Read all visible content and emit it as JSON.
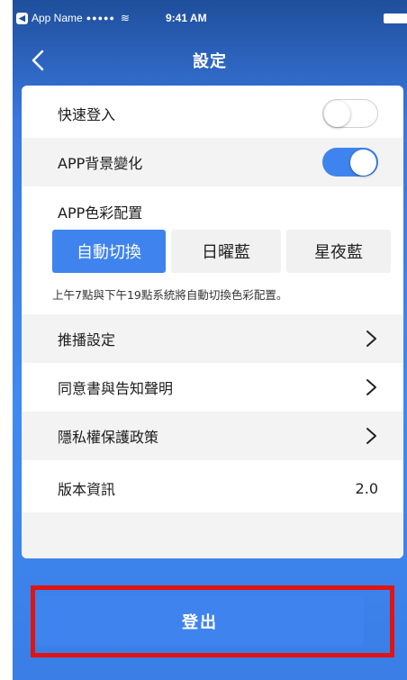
{
  "status_bar": {
    "back_app_label": "App Name",
    "back_app_badge": "◀",
    "signal": "●●●●●",
    "wifi": "≋",
    "time": "9:41 AM"
  },
  "nav": {
    "title": "設定",
    "back_icon": "chevron-left-icon"
  },
  "settings": {
    "quick_login": {
      "label": "快速登入",
      "enabled": false
    },
    "bg_change": {
      "label": "APP背景變化",
      "enabled": true
    },
    "color_config": {
      "title": "APP色彩配置",
      "options": [
        "自動切換",
        "日曜藍",
        "星夜藍"
      ],
      "selected": "自動切換",
      "note": "上午7點與下午19點系統將自動切換色彩配置。"
    },
    "push": {
      "label": "推播設定"
    },
    "consent": {
      "label": "同意書與告知聲明"
    },
    "privacy": {
      "label": "隱私權保護政策"
    },
    "version": {
      "label": "版本資訊",
      "value": "2.0"
    }
  },
  "logout": {
    "label": "登出"
  },
  "colors": {
    "accent": "#3f84ee",
    "highlight_border": "#e11414",
    "header_gradient_top": "#1f4f9c"
  }
}
